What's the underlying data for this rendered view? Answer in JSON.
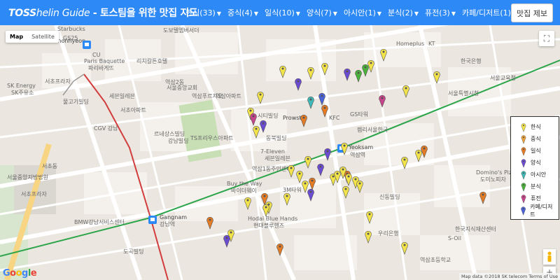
{
  "navbar": {
    "brand_part1": "TOSS",
    "brand_part2": "helin Guide",
    "brand_part3": " - 토스팀을 위한 맛집 지도",
    "items": [
      {
        "label": "한식(33)"
      },
      {
        "label": "중식(4)"
      },
      {
        "label": "일식(10)"
      },
      {
        "label": "양식(7)"
      },
      {
        "label": "아시안(1)"
      },
      {
        "label": "분식(2)"
      },
      {
        "label": "퓨전(3)"
      },
      {
        "label": "카페/디저트(1)"
      }
    ],
    "submit_label": "맛집 제보"
  },
  "map": {
    "map_type": [
      "Map",
      "Satellite"
    ],
    "attribution": "Map data ©2018 SK telecom   Terms of Use",
    "google_logo": [
      "G",
      "o",
      "o",
      "g",
      "l",
      "e"
    ],
    "labels": [
      "Starbucks",
      "GS25",
      "CU",
      "Sinnonhyeon",
      "리치칼튼호텔",
      "도보텔엠버서더",
      "Paris Baquette",
      "파리바게뜨",
      "SK Energy",
      "SK주유소",
      "서초프라자",
      "물고기빌딩",
      "서초아파트",
      "CGV 강남",
      "세븐일레븐",
      "역삼아파트",
      "르네상스빌딩",
      "강남빌딩",
      "역삼푸르지오",
      "역삼2동",
      "7-Eleven",
      "세븐일레븐",
      "서울중앙교회",
      "TS프리우스아파트",
      "동북빌딩",
      "시티빌딩",
      "Prowstar",
      "GS타워",
      "KFC",
      "렘리서울한국",
      "Yeoksam",
      "역삼역",
      "역삼1동주민센터",
      "Buy the Way",
      "바이더웨이",
      "3M타워",
      "BMW강남서비스센터",
      "Gangnam",
      "강남역",
      "Hodai Blue Hands",
      "현대블루핸즈",
      "도곡빌딩",
      "서초동",
      "서울중앙지방법원",
      "서초프라자",
      "Homeplus",
      "KT",
      "한국은행",
      "서울교육청",
      "서울특별시청",
      "신동빌딩",
      "Domino's Pizza",
      "도미노피자",
      "S-Oil",
      "역삼초등학교",
      "우리은행",
      "한국지식재산센터"
    ]
  },
  "legend": {
    "items": [
      {
        "label": "한식",
        "color": "#f2e34b"
      },
      {
        "label": "중식",
        "color": "#e9a23b"
      },
      {
        "label": "일식",
        "color": "#e47b25"
      },
      {
        "label": "양식",
        "color": "#6b4bd1"
      },
      {
        "label": "아시안",
        "color": "#3fb9b7"
      },
      {
        "label": "분식",
        "color": "#4ab13a"
      },
      {
        "label": "퓨전",
        "color": "#c8448a"
      },
      {
        "label": "카페/디저트",
        "color": "#4a62d8"
      }
    ]
  },
  "controls": {
    "zoom_in": "+",
    "zoom_out": "−",
    "fullscreen_icon": "fullscreen-icon"
  }
}
